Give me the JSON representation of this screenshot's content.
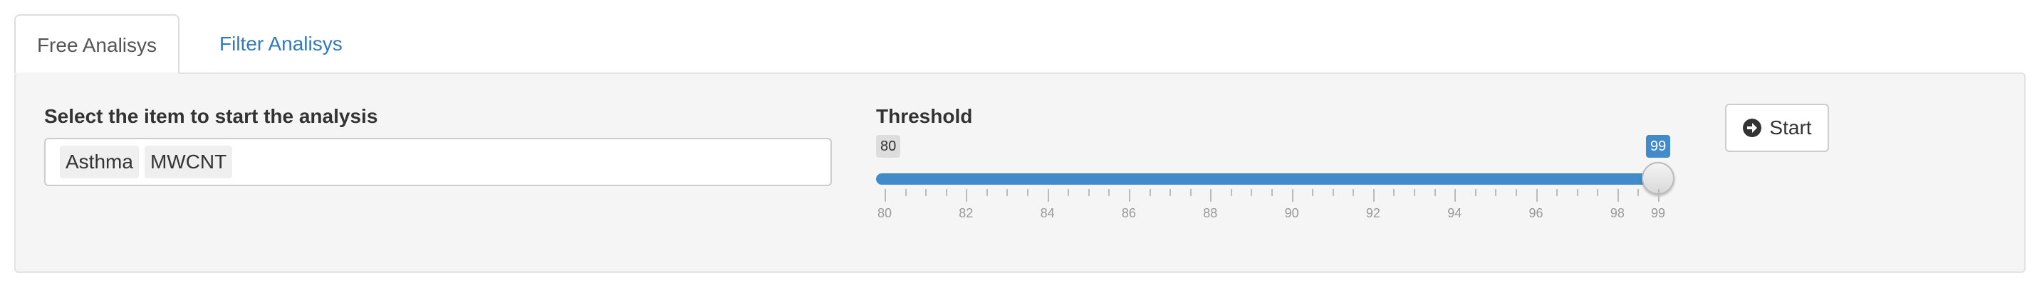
{
  "tabs": [
    {
      "label": "Free Analisys",
      "active": true
    },
    {
      "label": "Filter Analisys",
      "active": false
    }
  ],
  "item_select": {
    "label": "Select the item to start the analysis",
    "selected": [
      "Asthma",
      "MWCNT"
    ]
  },
  "threshold": {
    "label": "Threshold",
    "min": 80,
    "max": 99,
    "range_low": 80,
    "range_high": 99,
    "min_label": "80",
    "value_label": "99",
    "tick_labels": [
      "80",
      "82",
      "84",
      "86",
      "88",
      "90",
      "92",
      "94",
      "96",
      "98",
      "99"
    ]
  },
  "start_button": {
    "label": "Start",
    "icon": "arrow-circle-right-icon"
  },
  "colors": {
    "accent": "#428bca",
    "link": "#337ab7",
    "panel": "#f5f5f5"
  }
}
